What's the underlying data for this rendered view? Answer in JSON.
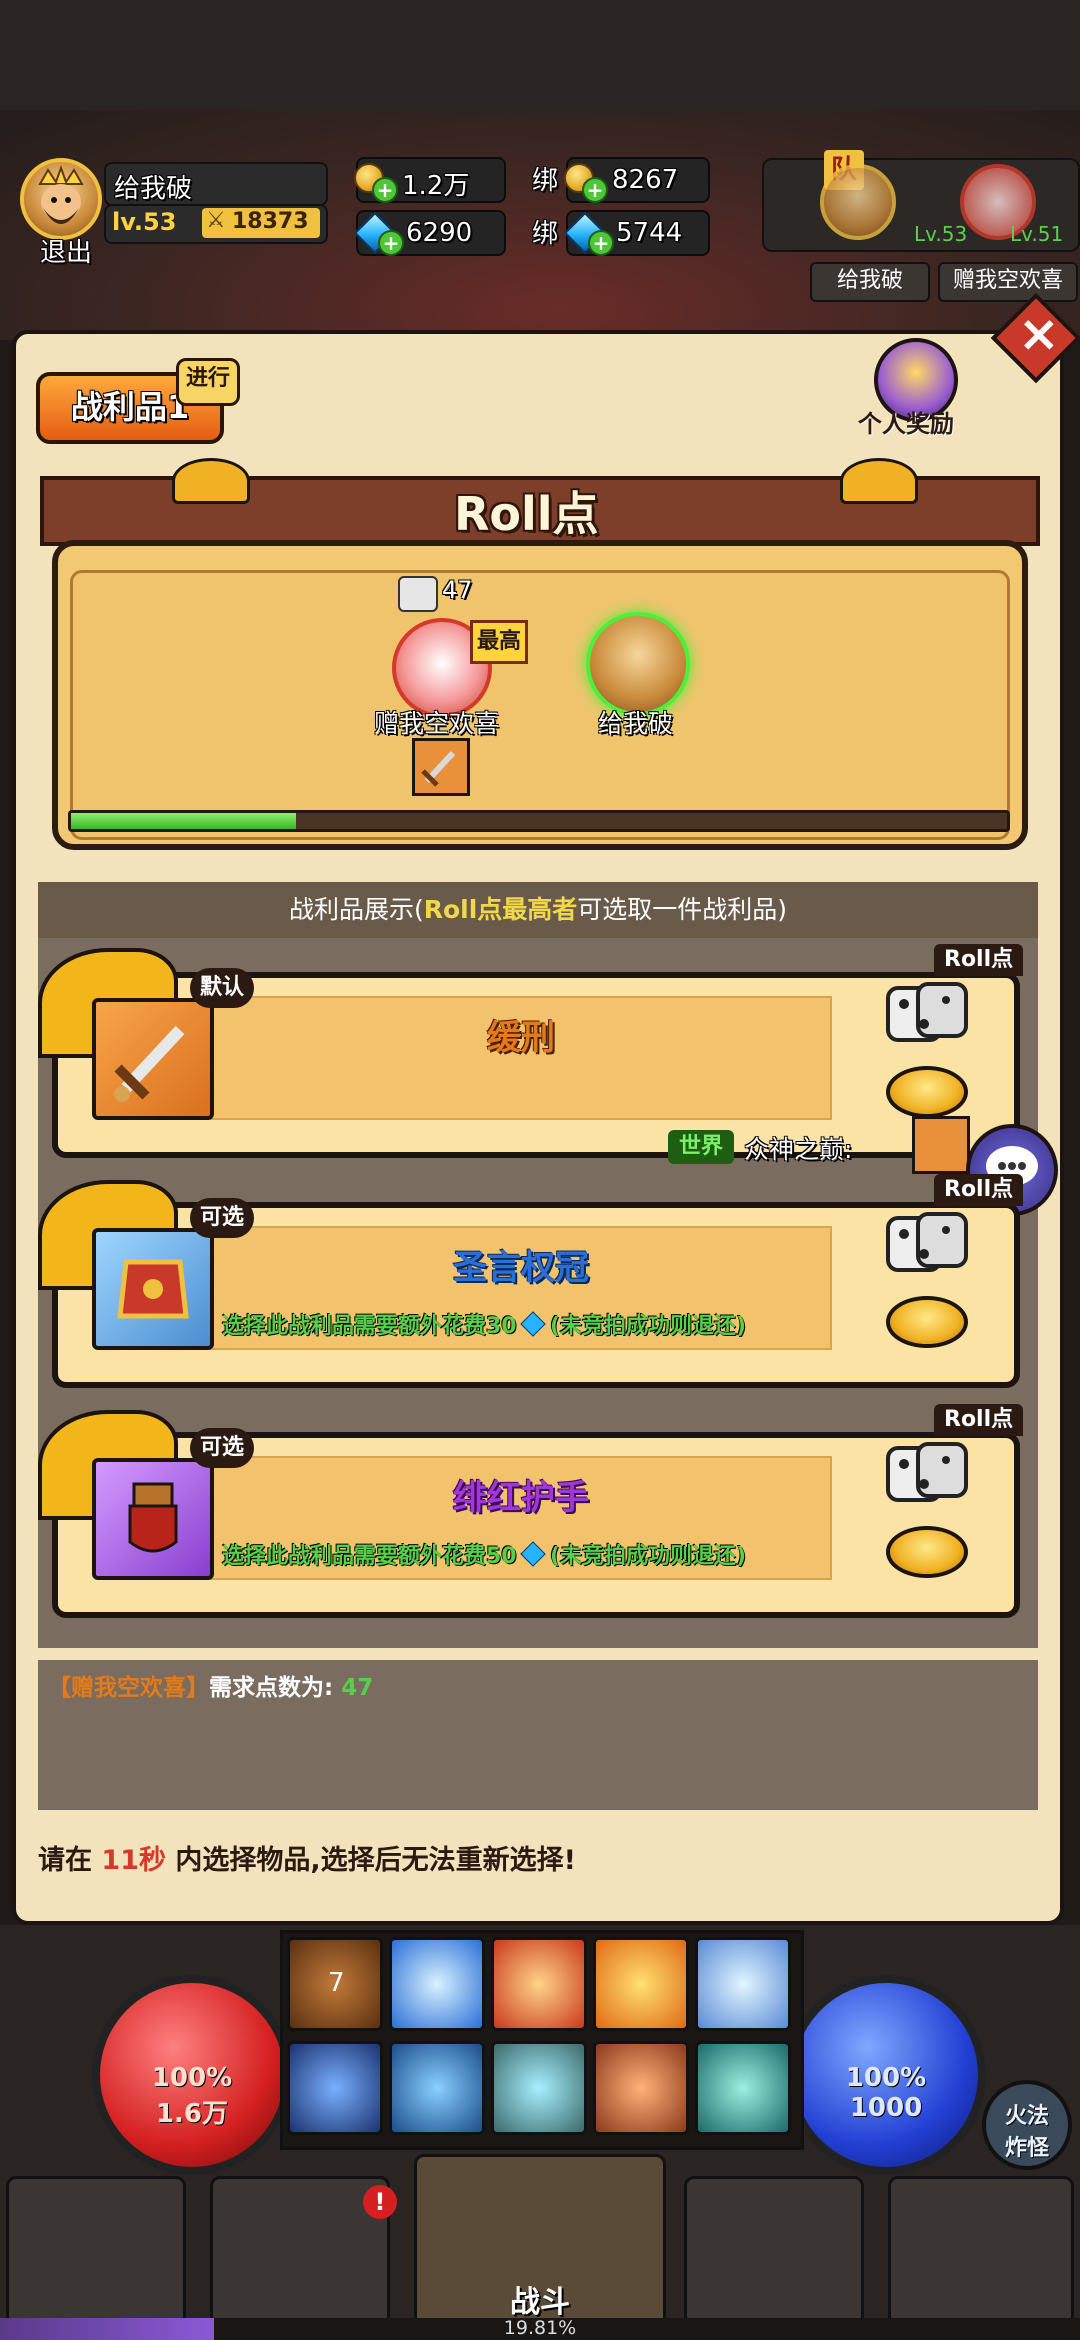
{
  "player": {
    "exit_label": "退出",
    "name": "给我破",
    "level": "lv.53",
    "power": "18373"
  },
  "resources": {
    "gold": "1.2万",
    "gems": "6290",
    "bound_label": "绑",
    "bound_gold": "8267",
    "bound_gems": "5744"
  },
  "team": {
    "tag": "队",
    "members": [
      {
        "level": "Lv.53",
        "name": "给我破"
      },
      {
        "level": "Lv.51",
        "name": "赠我空欢喜"
      }
    ]
  },
  "panel": {
    "tab_label": "战利品1",
    "tab_status": "进行",
    "personal_reward": "个人奖励",
    "roll_title": "Roll点",
    "roll_count": "47",
    "highest_badge": "最高",
    "players": [
      {
        "name": "赠我空欢喜"
      },
      {
        "name": "给我破"
      }
    ],
    "progress": 0.24,
    "loot_display_prefix": "战利品展示(",
    "loot_display_roll": "Roll点最高者",
    "loot_display_suffix": "可选取一件战利品)",
    "roll_tag": "Roll点",
    "items": [
      {
        "tag": "默认",
        "name": "缓刑",
        "note": ""
      },
      {
        "tag": "可选",
        "name": "圣言权冠",
        "note_prefix": "选择此战利品需要额外花费30",
        "note_suffix": "(未竞拍成功则退还)"
      },
      {
        "tag": "可选",
        "name": "绯红护手",
        "note_prefix": "选择此战利品需要额外花费50",
        "note_suffix": "(未竞拍成功则退还)"
      }
    ],
    "chat": {
      "channel": "世界",
      "text": "众神之巅:"
    },
    "demand_player": "【赠我空欢喜】",
    "demand_text": "需求点数为:",
    "demand_value": "47",
    "timer_prefix": "请在",
    "timer_value": "11秒",
    "timer_suffix": "内选择物品,选择后无法重新选择!"
  },
  "hud": {
    "hp_percent": "100%",
    "hp_value": "1.6万",
    "mp_percent": "100%",
    "mp_value": "1000",
    "skill_cooldown": "7",
    "auto_label_1": "火法",
    "auto_label_2": "炸怪",
    "nav_fight": "战斗",
    "exp_percent": "19.81%"
  },
  "colors": {
    "accent_orange": "#e45d12",
    "green": "#56d04a",
    "gold": "#f0c040",
    "blue_name": "#2a6fd6",
    "purple_name": "#a236d6",
    "orange_name": "#e47a18"
  }
}
